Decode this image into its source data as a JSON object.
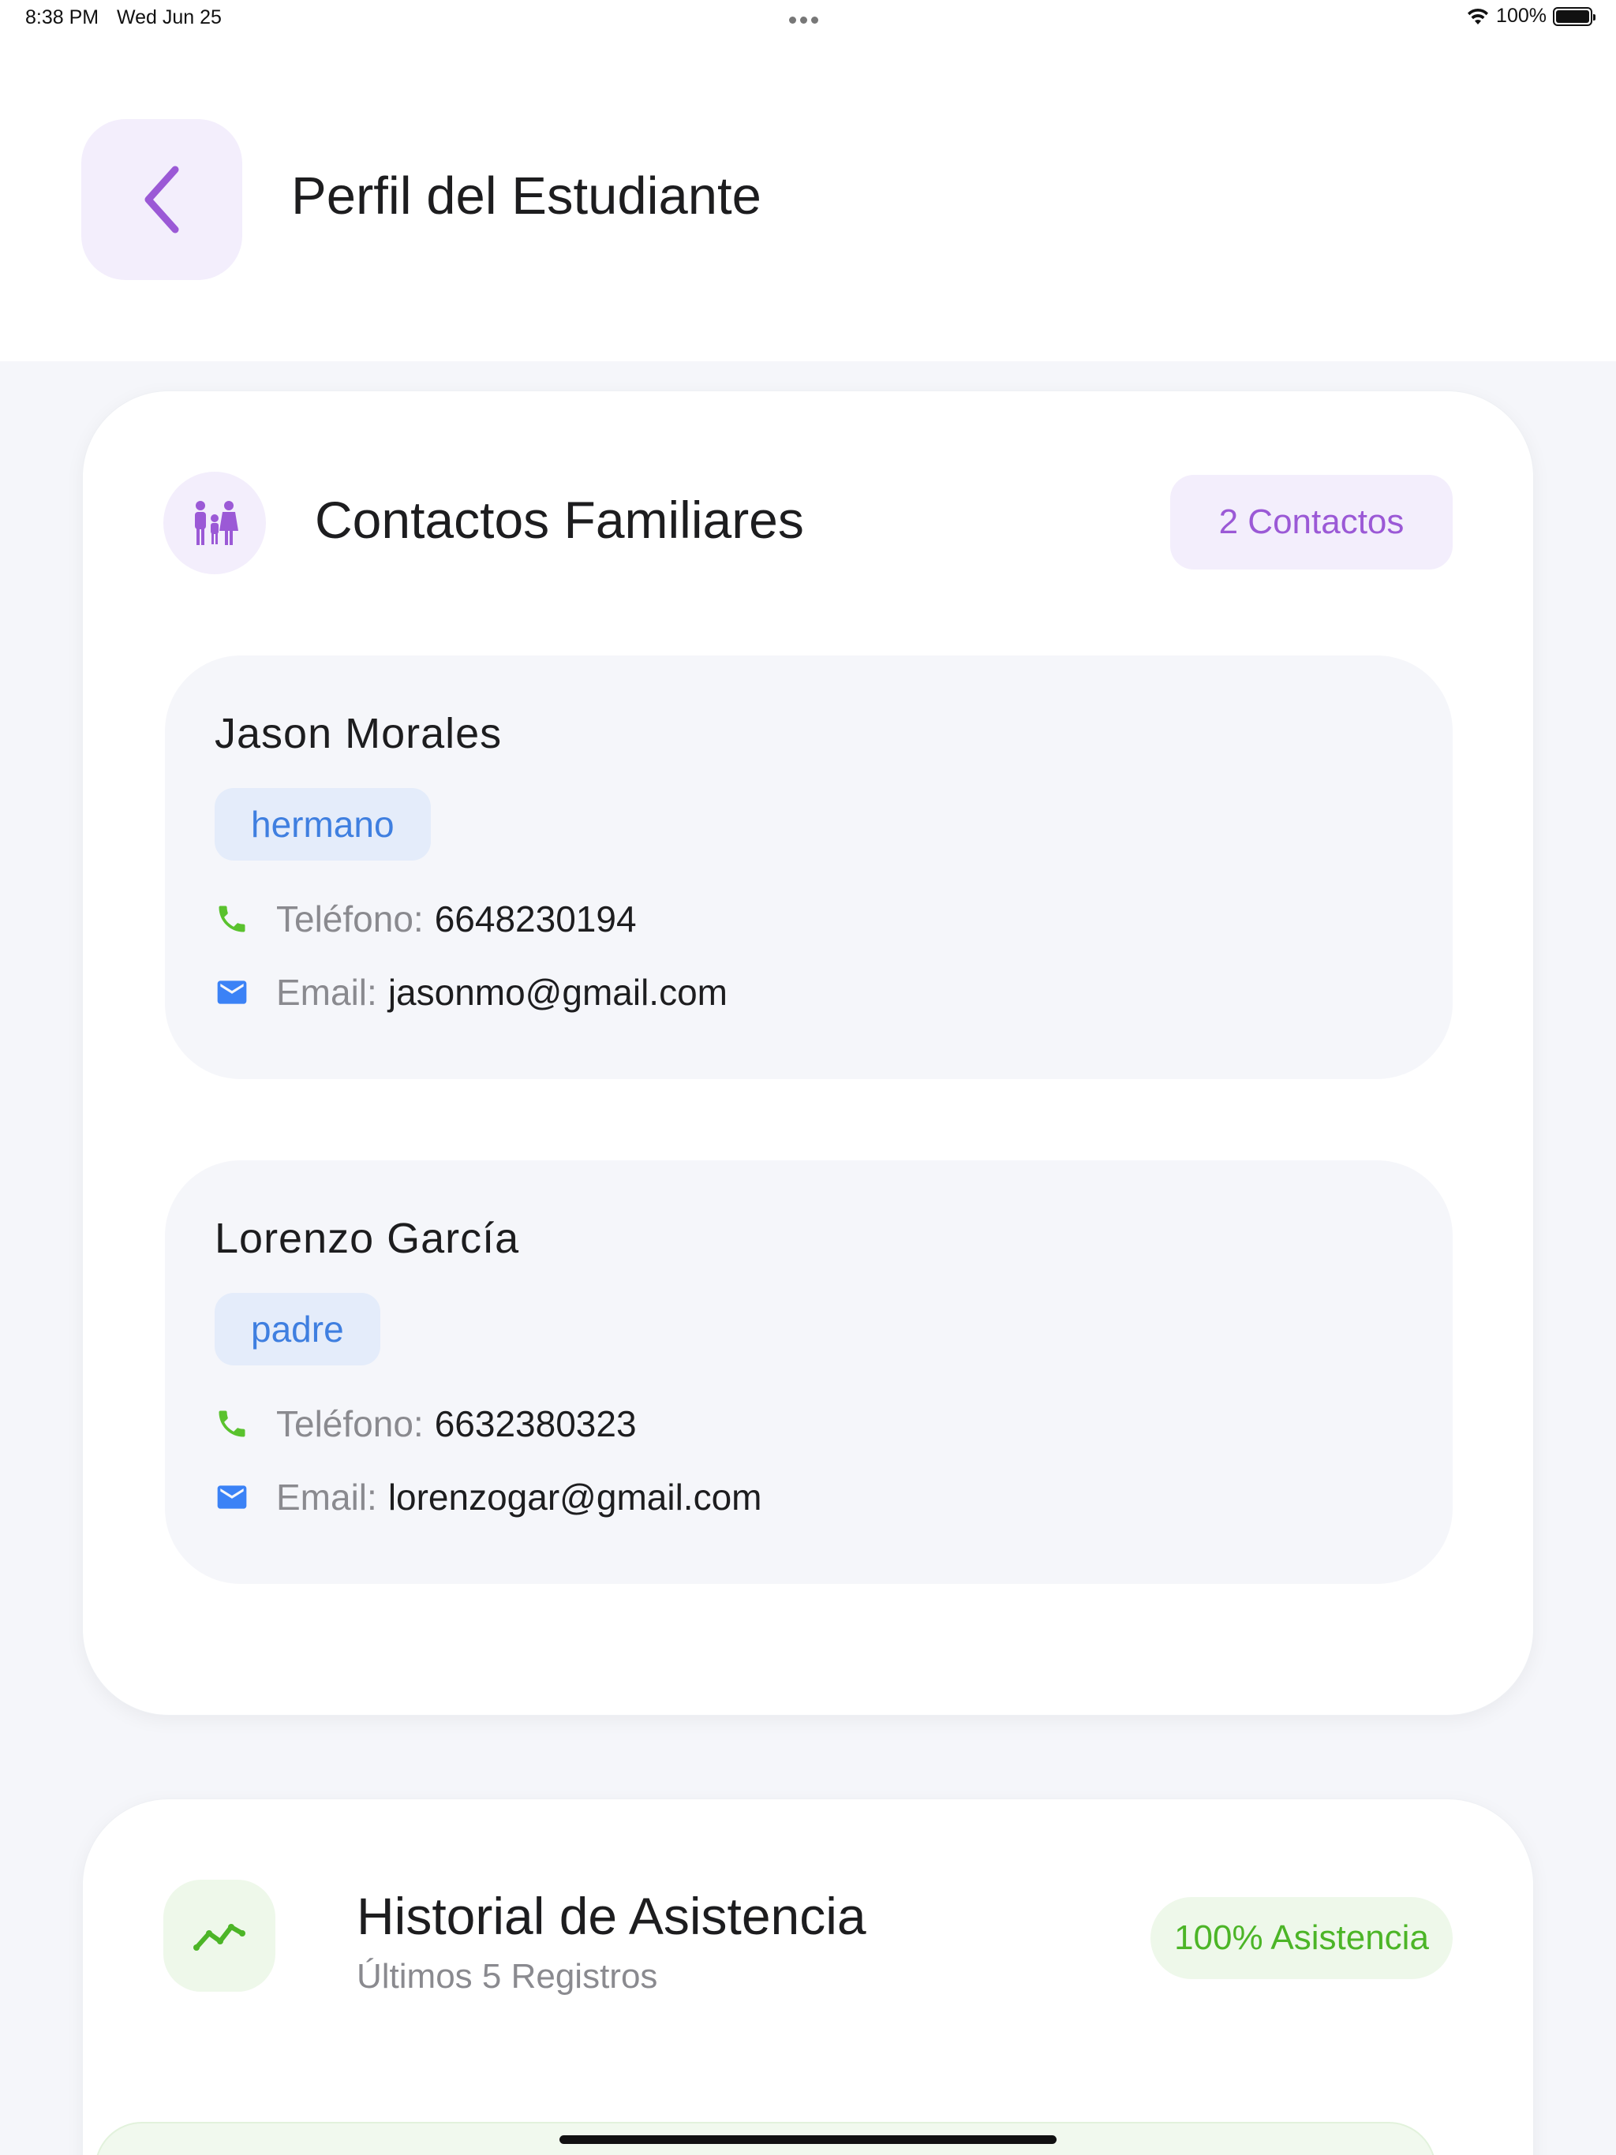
{
  "status_bar": {
    "time": "8:38 PM",
    "date": "Wed Jun 25",
    "battery": "100%"
  },
  "header": {
    "title": "Perfil del Estudiante"
  },
  "contacts_card": {
    "title": "Contactos Familiares",
    "count_badge": "2 Contactos",
    "contacts": [
      {
        "name": "Jason Morales",
        "relation": "hermano",
        "phone_label": "Teléfono:",
        "phone": "6648230194",
        "email_label": "Email:",
        "email": "jasonmo@gmail.com"
      },
      {
        "name": "Lorenzo García",
        "relation": "padre",
        "phone_label": "Teléfono:",
        "phone": "6632380323",
        "email_label": "Email:",
        "email": "lorenzogar@gmail.com"
      }
    ]
  },
  "history_card": {
    "title": "Historial de Asistencia",
    "subtitle": "Últimos 5 Registros",
    "badge": "100% Asistencia"
  },
  "icons": {
    "back": "chevron-left-icon",
    "family": "family-icon",
    "phone": "phone-icon",
    "email": "mail-icon",
    "trend": "trending-up-icon",
    "wifi": "wifi-icon",
    "battery": "battery-icon"
  },
  "colors": {
    "accent_purple": "#9b59d6",
    "accent_blue": "#3f7fe0",
    "accent_green": "#4cb527",
    "phone_green": "#5ac22e",
    "mail_blue": "#3b82f6"
  }
}
